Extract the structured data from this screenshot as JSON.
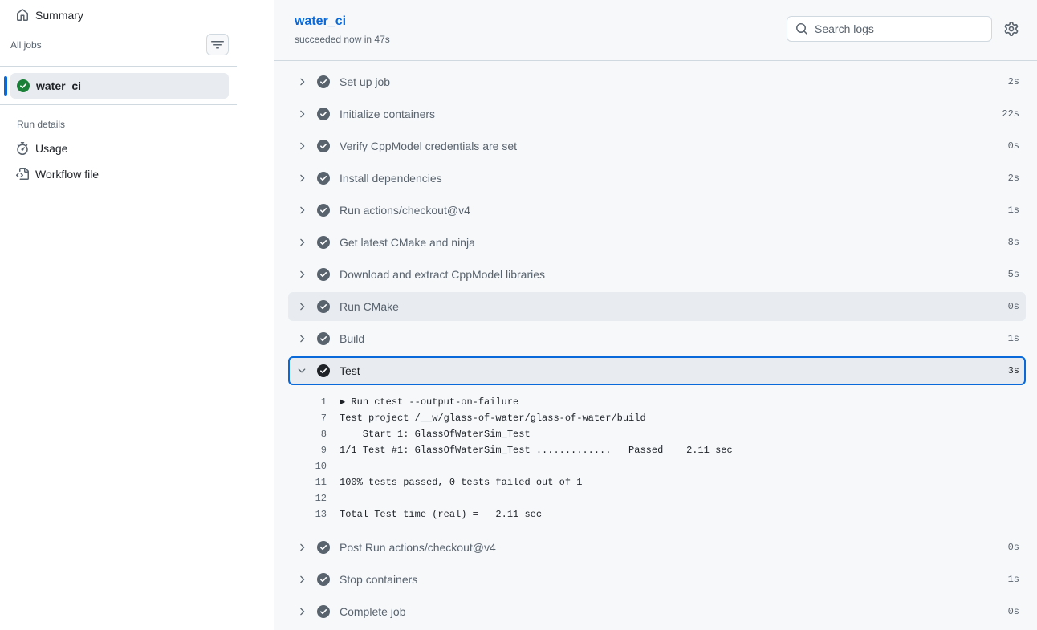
{
  "sidebar": {
    "summary_label": "Summary",
    "all_jobs_label": "All jobs",
    "job": {
      "label": "water_ci",
      "status": "success"
    },
    "run_details_label": "Run details",
    "usage_label": "Usage",
    "workflow_file_label": "Workflow file"
  },
  "header": {
    "job_title": "water_ci",
    "status_text": "succeeded now in 47s",
    "search_placeholder": "Search logs"
  },
  "steps": [
    {
      "name": "Set up job",
      "time": "2s"
    },
    {
      "name": "Initialize containers",
      "time": "22s"
    },
    {
      "name": "Verify CppModel credentials are set",
      "time": "0s"
    },
    {
      "name": "Install dependencies",
      "time": "2s"
    },
    {
      "name": "Run actions/checkout@v4",
      "time": "1s"
    },
    {
      "name": "Get latest CMake and ninja",
      "time": "8s"
    },
    {
      "name": "Download and extract CppModel libraries",
      "time": "5s"
    },
    {
      "name": "Run CMake",
      "time": "0s"
    },
    {
      "name": "Build",
      "time": "1s"
    },
    {
      "name": "Test",
      "time": "3s",
      "expanded": true
    },
    {
      "name": "Post Run actions/checkout@v4",
      "time": "0s"
    },
    {
      "name": "Stop containers",
      "time": "1s"
    },
    {
      "name": "Complete job",
      "time": "0s"
    }
  ],
  "log_lines": [
    {
      "num": "1",
      "text": "▶ Run ctest --output-on-failure"
    },
    {
      "num": "7",
      "text": "Test project /__w/glass-of-water/glass-of-water/build"
    },
    {
      "num": "8",
      "text": "    Start 1: GlassOfWaterSim_Test"
    },
    {
      "num": "9",
      "text": "1/1 Test #1: GlassOfWaterSim_Test .............   Passed    2.11 sec"
    },
    {
      "num": "10",
      "text": ""
    },
    {
      "num": "11",
      "text": "100% tests passed, 0 tests failed out of 1"
    },
    {
      "num": "12",
      "text": ""
    },
    {
      "num": "13",
      "text": "Total Test time (real) =   2.11 sec"
    }
  ],
  "colors": {
    "accent": "#0969da",
    "success": "#1a7f37",
    "muted": "#59636e"
  }
}
